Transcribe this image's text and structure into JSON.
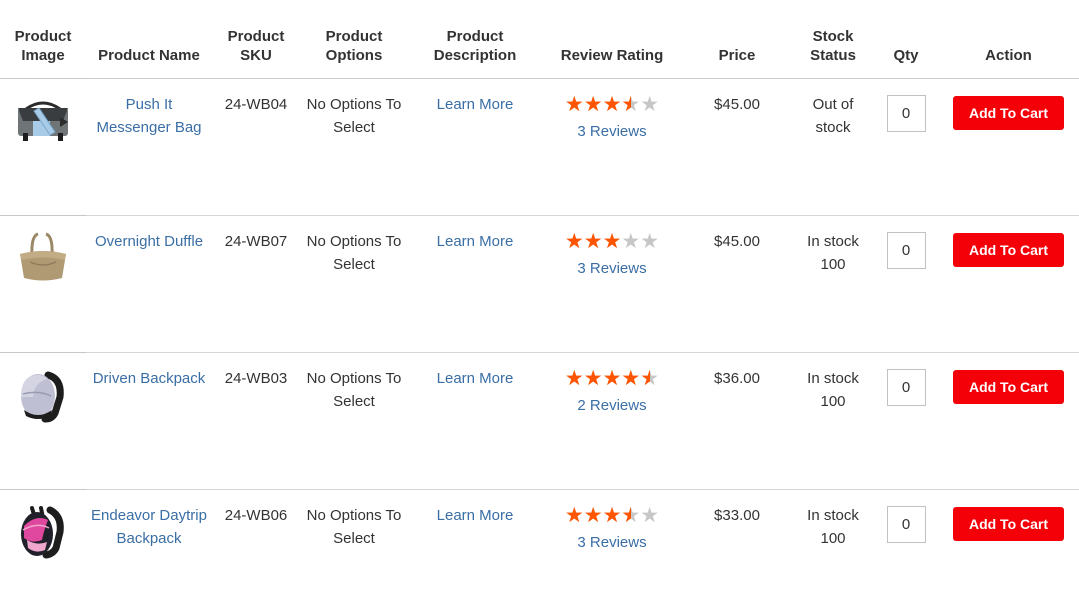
{
  "table": {
    "headers": [
      {
        "id": "product-image",
        "label": "Product Image"
      },
      {
        "id": "product-name",
        "label": "Product Name"
      },
      {
        "id": "product-sku",
        "label": "Product SKU"
      },
      {
        "id": "product-options",
        "label": "Product Options"
      },
      {
        "id": "product-description",
        "label": "Product Description"
      },
      {
        "id": "review-rating",
        "label": "Review Rating"
      },
      {
        "id": "price",
        "label": "Price"
      },
      {
        "id": "stock-status",
        "label": "Stock Status"
      },
      {
        "id": "qty",
        "label": "Qty"
      },
      {
        "id": "action",
        "label": "Action"
      }
    ],
    "rows": [
      {
        "image_icon": "messenger-bag-thumbnail",
        "name": "Push It Messenger Bag",
        "sku": "24-WB04",
        "options": "No Options To Select",
        "description_link": "Learn More",
        "rating_stars": 3.5,
        "reviews": "3 Reviews",
        "price": "$45.00",
        "stock_status": "Out of stock",
        "stock_qty": "",
        "qty_value": "0",
        "action_label": "Add To Cart"
      },
      {
        "image_icon": "duffle-bag-thumbnail",
        "name": "Overnight Duffle",
        "sku": "24-WB07",
        "options": "No Options To Select",
        "description_link": "Learn More",
        "rating_stars": 3,
        "reviews": "3 Reviews",
        "price": "$45.00",
        "stock_status": "In stock",
        "stock_qty": "100",
        "qty_value": "0",
        "action_label": "Add To Cart"
      },
      {
        "image_icon": "driven-backpack-thumbnail",
        "name": "Driven Backpack",
        "sku": "24-WB03",
        "options": "No Options To Select",
        "description_link": "Learn More",
        "rating_stars": 4.5,
        "reviews": "2 Reviews",
        "price": "$36.00",
        "stock_status": "In stock",
        "stock_qty": "100",
        "qty_value": "0",
        "action_label": "Add To Cart"
      },
      {
        "image_icon": "daytrip-backpack-thumbnail",
        "name": "Endeavor Daytrip Backpack",
        "sku": "24-WB06",
        "options": "No Options To Select",
        "description_link": "Learn More",
        "rating_stars": 3.5,
        "reviews": "3 Reviews",
        "price": "$33.00",
        "stock_status": "In stock",
        "stock_qty": "100",
        "qty_value": "0",
        "action_label": "Add To Cart"
      }
    ]
  },
  "colors": {
    "star_filled": "#ff5501",
    "star_empty": "#c7c7c7",
    "link": "#3a6ea5",
    "cart_button": "#f40009",
    "text": "#333333",
    "row_border": "#d6d6d6"
  }
}
